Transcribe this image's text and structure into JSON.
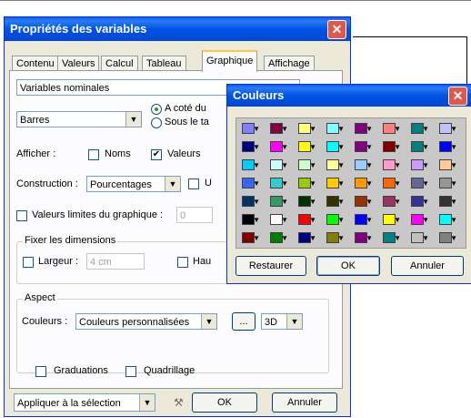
{
  "main_dialog": {
    "title": "Propriétés des variables",
    "tabs": [
      {
        "label": "Contenu",
        "active": false
      },
      {
        "label": "Valeurs",
        "active": false
      },
      {
        "label": "Calcul",
        "active": false
      },
      {
        "label": "Tableau",
        "active": false
      },
      {
        "label": "Graphique",
        "active": true
      },
      {
        "label": "Affichage",
        "active": false
      }
    ],
    "variable_type": "Variables nominales",
    "chart_type": "Barres",
    "legend_position": {
      "opt1": "A coté du",
      "opt2": "Sous le ta"
    },
    "afficher": {
      "label": "Afficher :",
      "noms": "Noms",
      "valeurs": "Valeurs"
    },
    "construction": {
      "label": "Construction :",
      "value": "Pourcentages",
      "chk_label": "U"
    },
    "limits": {
      "label": "Valeurs limites du graphique :",
      "value": "0"
    },
    "dimensions": {
      "legend": "Fixer les dimensions",
      "largeur_label": "Largeur :",
      "largeur_value": "4 cm",
      "hauteur_label": "Hau"
    },
    "aspect": {
      "legend": "Aspect",
      "couleurs_label": "Couleurs :",
      "couleurs_value": "Couleurs personnalisées",
      "more_label": "...",
      "mode": "3D"
    },
    "graduations": "Graduations",
    "quadrillage": "Quadrillage",
    "apply_scope": "Appliquer à la sélection",
    "ok": "OK",
    "cancel": "Annuler"
  },
  "colors_dialog": {
    "title": "Couleurs",
    "restore": "Restaurer",
    "ok": "OK",
    "cancel": "Annuler",
    "swatches": [
      [
        "#8080ff",
        "#800040",
        "#ffff80",
        "#80ffff",
        "#800080",
        "#ff8080",
        "#008080",
        "#c0c0ff"
      ],
      [
        "#000080",
        "#ff00ff",
        "#ffff00",
        "#00ffff",
        "#800080",
        "#800000",
        "#008080",
        "#0000ff"
      ],
      [
        "#00ccff",
        "#ccffff",
        "#ccffcc",
        "#ffff99",
        "#99ccff",
        "#ff99cc",
        "#cc99ff",
        "#ffcc99"
      ],
      [
        "#3366ff",
        "#33cccc",
        "#99cc00",
        "#ffcc00",
        "#ff9900",
        "#ff6600",
        "#666699",
        "#969696"
      ],
      [
        "#003366",
        "#339966",
        "#003300",
        "#333300",
        "#993300",
        "#993366",
        "#333399",
        "#333333"
      ],
      [
        "#000000",
        "#ffffff",
        "#ff0000",
        "#00ff00",
        "#0000ff",
        "#ffff00",
        "#ff00ff",
        "#00ffff"
      ],
      [
        "#800000",
        "#008000",
        "#000080",
        "#808000",
        "#800080",
        "#008080",
        "#c0c0c0",
        "#808080"
      ]
    ]
  }
}
